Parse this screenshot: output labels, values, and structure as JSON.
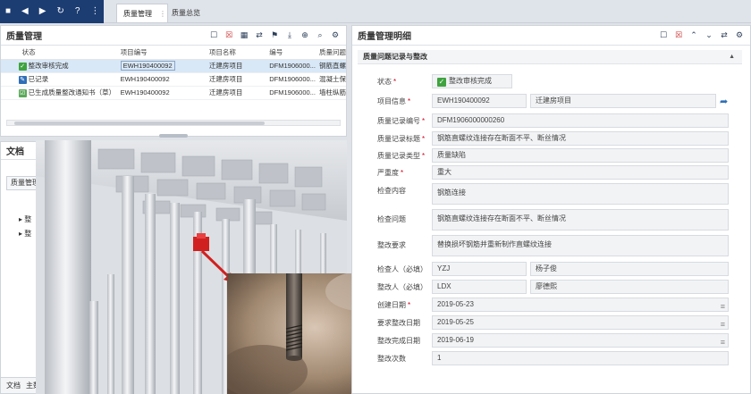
{
  "topbar": {
    "tabs": [
      {
        "label": "质量管理"
      },
      {
        "label": "质量总览"
      }
    ]
  },
  "left_panel": {
    "title": "质量管理",
    "columns": [
      "状态",
      "项目编号",
      "项目名称",
      "编号",
      "质量问题"
    ],
    "rows": [
      {
        "status": "整改审核完成",
        "project_no": "EWH190400092",
        "project_name": "迁建房项目",
        "code": "DFM1906000...",
        "issue": "钢筋直螺"
      },
      {
        "status": "已记录",
        "project_no": "EWH190400092",
        "project_name": "迁建房项目",
        "code": "DFM1906000...",
        "issue": "混凝土保"
      },
      {
        "status": "已生成质量整改通知书（草）",
        "project_no": "EWH190400092",
        "project_name": "迁建房项目",
        "code": "DFM1906000...",
        "issue": "墙柱纵筋"
      }
    ]
  },
  "docs_panel": {
    "title": "文档",
    "button_label": "质量管理",
    "tree_items": [
      "整",
      "整"
    ],
    "bottom_tabs": [
      "文档",
      "主数据纯文本"
    ]
  },
  "right_panel": {
    "title": "质量管理明细",
    "section": "质量问题记录与整改",
    "fields": {
      "status": {
        "label": "状态",
        "value": "整改审核完成"
      },
      "project": {
        "label": "项目信息",
        "code": "EWH190400092",
        "name": "迁建房项目"
      },
      "record_no": {
        "label": "质量记录编号",
        "value": "DFM1906000000260"
      },
      "record_title": {
        "label": "质量记录标题",
        "value": "钢筋直螺纹连接存在断面不平、断丝情况"
      },
      "record_type": {
        "label": "质量记录类型",
        "value": "质量缺陷"
      },
      "severity": {
        "label": "严重度",
        "value": "重大"
      },
      "check_content": {
        "label": "检查内容",
        "value": "钢筋连接"
      },
      "check_issue": {
        "label": "检查问题",
        "value": "钢筋直螺纹连接存在断面不平、断丝情况"
      },
      "fix_requirement": {
        "label": "整改要求",
        "value": "替换损坏钢筋并重新制作直螺纹连接"
      },
      "inspector": {
        "label": "检查人（必填）",
        "code": "YZJ",
        "name": "杨子俊"
      },
      "rectifier": {
        "label": "整改人（必填）",
        "code": "LDX",
        "name": "廖德熙"
      },
      "created_date": {
        "label": "创建日期",
        "value": "2019-05-23"
      },
      "required_date": {
        "label": "要求整改日期",
        "value": "2019-05-25"
      },
      "done_date": {
        "label": "整改完成日期",
        "value": "2019-06-19"
      },
      "times": {
        "label": "整改次数",
        "value": "1"
      }
    }
  }
}
